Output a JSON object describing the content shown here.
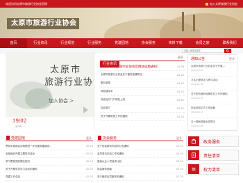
{
  "topbar": {
    "welcome": "欢迎访问太原市旅游行业协会官网",
    "favorite": "加入太原旅游行业协会"
  },
  "banner": {
    "title": "太原市旅游行业协会"
  },
  "nav": {
    "items": [
      "首页",
      "行业资讯",
      "行业规范",
      "行业服务",
      "党建园地",
      "协会服务",
      "资料下载",
      "会员之家",
      "联系我们"
    ]
  },
  "search": {
    "placeholder": "请输入搜索关键字"
  },
  "slider": {
    "title_line1": "太原市",
    "title_line2": "旅游行业协会",
    "join": "加入协会 >",
    "day": "19/02",
    "year": "2020"
  },
  "news": {
    "tab": "行业资讯",
    "more": "更多",
    "items": [
      {
        "title": "关于太原市旅游行业协会官网站征稿通知!",
        "date": "01-09",
        "highlight": true
      },
      {
        "title": "太原市旅游行业协会关于做好疫情防控...",
        "date": "02-20"
      },
      {
        "title": "图片新闻",
        "date": "02-25"
      },
      {
        "title": "网站建设中",
        "date": "02-25"
      },
      {
        "title": "协会官方门户网站上线",
        "date": "02-25"
      },
      {
        "title": "协会简介",
        "date": "02-25"
      },
      {
        "title": "关于开展年度工作的通知",
        "date": "02-25"
      }
    ]
  },
  "notice": {
    "title": "通知公告",
    "more": "更多",
    "items": [
      {
        "title": "太原市旅游行业协会关于开展...",
        "date": "2020-03-20"
      },
      {
        "title": "万名小程序学习考试活动",
        "date": "2020-03-05"
      },
      {
        "title": "关于配合做好疫情防控工作的通知",
        "date": "2020-02-25"
      },
      {
        "title": "协会网站正式上线运营",
        "date": "2020-02-21"
      },
      {
        "title": "五一期间游客出游提示",
        "date": "2020-04-28"
      }
    ]
  },
  "party": {
    "title": "党建园地",
    "more": "更多",
    "items": [
      {
        "title": "贯彻中宣部会议精神进一步加强党建建设...",
        "date": "02-25"
      },
      {
        "title": "支部组织开展主题党日活动",
        "date": "02-25"
      },
      {
        "title": "学习贯彻党的理论知识",
        "date": "02-25"
      },
      {
        "title": "关于开展党员学习活动的通知",
        "date": "02-25"
      },
      {
        "title": "党建工作总结",
        "date": "02-25"
      }
    ]
  },
  "assoc": {
    "title": "协会服务",
    "more": "更多",
    "items": [
      {
        "title": "关于协会服务内容的公告通知",
        "date": "02-25"
      },
      {
        "title": "会员单位年检工作的通知",
        "date": "02-25"
      },
      {
        "title": "旅游从业人员培训计划",
        "date": "02-25"
      },
      {
        "title": "协会服务指南",
        "date": "02-25"
      },
      {
        "title": "关于做好会员服务的通知",
        "date": "02-25"
      }
    ]
  },
  "quick": [
    "政务服务",
    "责任清单",
    "权力清单"
  ],
  "colors": {
    "brand": "#c8161d",
    "banner_bg": "#7a6a4c"
  }
}
